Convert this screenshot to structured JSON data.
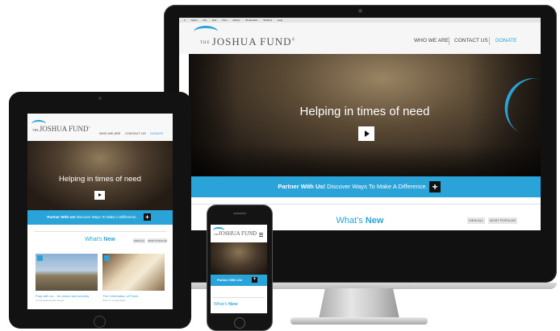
{
  "menubar": {
    "items": [
      "Safari",
      "File",
      "Edit",
      "View",
      "History",
      "Bookmarks",
      "Window",
      "Help"
    ]
  },
  "brand": {
    "the": "THE",
    "name": "JOSHUA FUND",
    "mark": "®"
  },
  "nav": {
    "who_we_are": "WHO WE ARE",
    "contact_us": "CONTACT US",
    "donate": "DONATE"
  },
  "hero": {
    "title": "Helping in times of need"
  },
  "partner": {
    "bold": "Partner With Us!",
    "text": " Discover Ways To Make A Difference.",
    "plus": "+"
  },
  "whats_new": {
    "light": "What's ",
    "bold": "New",
    "view_all": "VIEW ALL",
    "most_popular": "MOST POPULAR"
  },
  "tablet_posts": [
    {
      "title": "Pray with us… for peace and security",
      "subtitle": "on the Israel-Syrian border"
    },
    {
      "title": "The Celebration of Purim",
      "subtitle": "Purim is a joyful feast"
    }
  ],
  "colors": {
    "accent": "#2aa4d8",
    "dark": "#111111"
  }
}
